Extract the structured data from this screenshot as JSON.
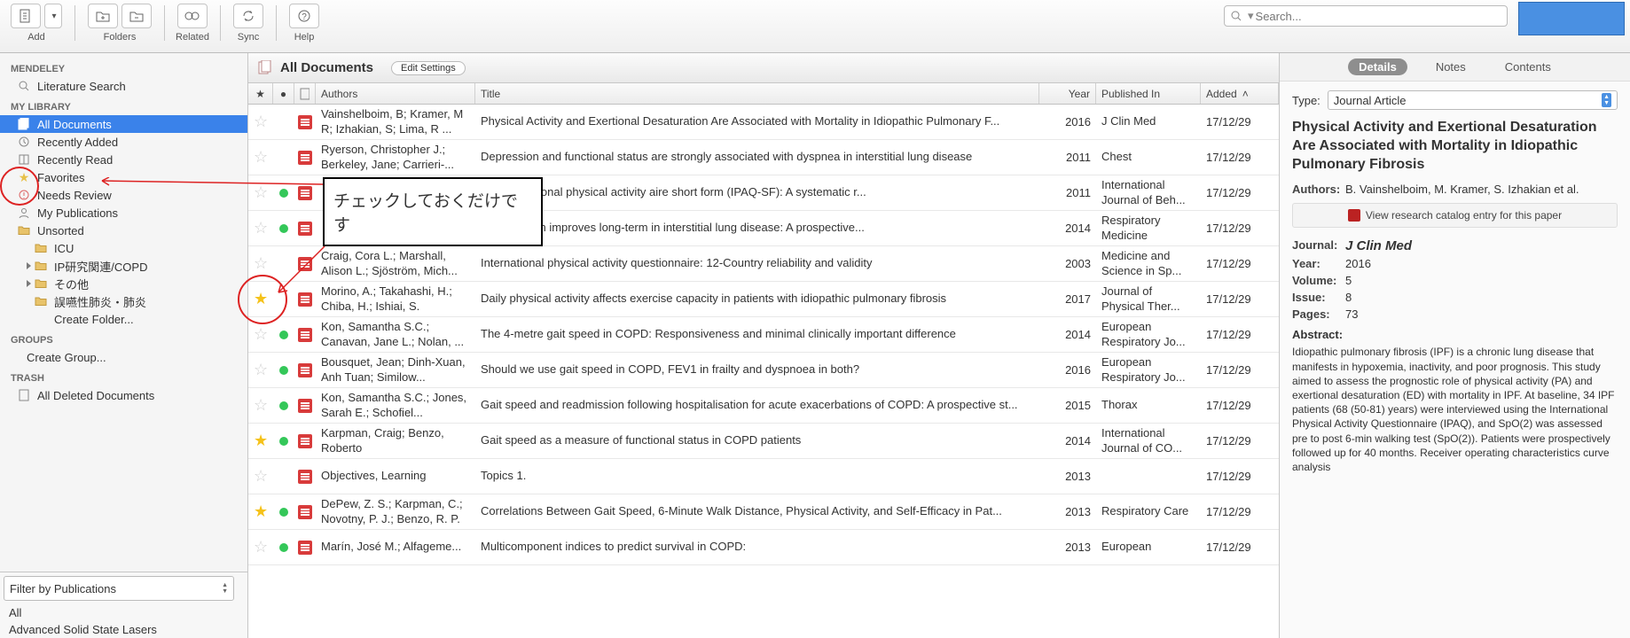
{
  "toolbar": {
    "groups": [
      {
        "label": "Add",
        "icons": [
          "file-add",
          "caret-down"
        ]
      },
      {
        "label": "Folders",
        "icons": [
          "folder-new",
          "folder-del"
        ]
      },
      {
        "label": "Related",
        "icons": [
          "related"
        ]
      },
      {
        "label": "Sync",
        "icons": [
          "sync"
        ]
      },
      {
        "label": "Help",
        "icons": [
          "help"
        ]
      }
    ],
    "search_placeholder": "Search..."
  },
  "sidebar": {
    "mendeley_head": "MENDELEY",
    "lit_search": "Literature Search",
    "lib_head": "MY LIBRARY",
    "items": [
      {
        "label": "All Documents",
        "sel": true,
        "icon": "docs"
      },
      {
        "label": "Recently Added",
        "icon": "clock"
      },
      {
        "label": "Recently Read",
        "icon": "book"
      },
      {
        "label": "Favorites",
        "icon": "star"
      },
      {
        "label": "Needs Review",
        "icon": "warn"
      },
      {
        "label": "My Publications",
        "icon": "user"
      },
      {
        "label": "Unsorted",
        "icon": "folder"
      },
      {
        "label": "ICU",
        "icon": "folder",
        "sub": true
      },
      {
        "label": "IP研究関連/COPD",
        "icon": "folder",
        "sub": true,
        "tri": true
      },
      {
        "label": "その他",
        "icon": "folder",
        "sub": true,
        "tri": true
      },
      {
        "label": "誤嚥性肺炎・肺炎",
        "icon": "folder",
        "sub": true
      },
      {
        "label": "Create Folder...",
        "icon": "none",
        "sub": true
      }
    ],
    "groups_head": "GROUPS",
    "create_group": "Create Group...",
    "trash_head": "TRASH",
    "deleted": "All Deleted Documents",
    "filter_label": "Filter by Publications",
    "filter_items": [
      "All",
      "Advanced Solid State Lasers"
    ]
  },
  "center": {
    "title": "All Documents",
    "edit": "Edit Settings",
    "cols": {
      "authors": "Authors",
      "title": "Title",
      "year": "Year",
      "pub": "Published In",
      "added": "Added"
    },
    "rows": [
      {
        "fav": false,
        "unread": false,
        "pdf": true,
        "authors": "Vainshelboim, B; Kramer, M R; Izhakian, S; Lima, R ...",
        "title": "Physical Activity and Exertional Desaturation Are Associated with Mortality in Idiopathic Pulmonary F...",
        "year": "2016",
        "pub": "J Clin Med",
        "added": "17/12/29"
      },
      {
        "fav": false,
        "unread": false,
        "pdf": true,
        "authors": "Ryerson, Christopher J.; Berkeley, Jane; Carrieri-...",
        "title": "Depression and functional status are strongly associated with dyspnea in interstitial lung disease",
        "year": "2011",
        "pub": "Chest",
        "added": "17/12/29"
      },
      {
        "fav": false,
        "unread": true,
        "pdf": true,
        "authors": "",
        "title": "the international physical activity aire short form (IPAQ-SF): A systematic r...",
        "year": "2011",
        "pub": "International Journal of Beh...",
        "added": "17/12/29"
      },
      {
        "fav": false,
        "unread": true,
        "pdf": true,
        "authors": "",
        "title": "rehabilitation improves long-term in interstitial lung disease: A prospective...",
        "year": "2014",
        "pub": "Respiratory Medicine",
        "added": "17/12/29"
      },
      {
        "fav": false,
        "unread": false,
        "pdf": true,
        "authors": "Craig, Cora L.; Marshall, Alison L.; Sjöström, Mich...",
        "title": "International physical activity questionnaire: 12-Country reliability and validity",
        "year": "2003",
        "pub": "Medicine and Science in Sp...",
        "added": "17/12/29"
      },
      {
        "fav": true,
        "unread": false,
        "pdf": true,
        "authors": "Morino, A.; Takahashi, H.; Chiba, H.; Ishiai, S.",
        "title": "Daily physical activity affects exercise capacity in patients with idiopathic pulmonary fibrosis",
        "year": "2017",
        "pub": "Journal of Physical Ther...",
        "added": "17/12/29"
      },
      {
        "fav": false,
        "unread": true,
        "pdf": true,
        "authors": "Kon, Samantha S.C.; Canavan, Jane L.; Nolan, ...",
        "title": "The 4-metre gait speed in COPD: Responsiveness and minimal clinically important difference",
        "year": "2014",
        "pub": "European Respiratory Jo...",
        "added": "17/12/29"
      },
      {
        "fav": false,
        "unread": true,
        "pdf": true,
        "authors": "Bousquet, Jean; Dinh-Xuan, Anh Tuan; Similow...",
        "title": "Should we use gait speed in COPD, FEV1 in frailty and dyspnoea in both?",
        "year": "2016",
        "pub": "European Respiratory Jo...",
        "added": "17/12/29"
      },
      {
        "fav": false,
        "unread": true,
        "pdf": true,
        "authors": "Kon, Samantha S.C.; Jones, Sarah E.; Schofiel...",
        "title": "Gait speed and readmission following hospitalisation for acute exacerbations of COPD: A prospective st...",
        "year": "2015",
        "pub": "Thorax",
        "added": "17/12/29"
      },
      {
        "fav": true,
        "unread": true,
        "pdf": true,
        "authors": "Karpman, Craig; Benzo, Roberto",
        "title": "Gait speed as a measure of functional status in COPD patients",
        "year": "2014",
        "pub": "International Journal of CO...",
        "added": "17/12/29"
      },
      {
        "fav": false,
        "unread": false,
        "pdf": true,
        "authors": "Objectives, Learning",
        "title": "Topics 1.",
        "year": "2013",
        "pub": "",
        "added": "17/12/29"
      },
      {
        "fav": true,
        "unread": true,
        "pdf": true,
        "authors": "DePew, Z. S.; Karpman, C.; Novotny, P. J.; Benzo, R. P.",
        "title": "Correlations Between Gait Speed, 6-Minute Walk Distance, Physical Activity, and Self-Efficacy in Pat...",
        "year": "2013",
        "pub": "Respiratory Care",
        "added": "17/12/29"
      },
      {
        "fav": false,
        "unread": true,
        "pdf": true,
        "authors": "Marín, José M.; Alfageme...",
        "title": "Multicomponent indices to predict survival in COPD:",
        "year": "2013",
        "pub": "European",
        "added": "17/12/29"
      }
    ]
  },
  "annotation": {
    "text": "チェックしておくだけです"
  },
  "details": {
    "tabs": [
      "Details",
      "Notes",
      "Contents"
    ],
    "type_label": "Type:",
    "type_value": "Journal Article",
    "title": "Physical Activity and Exertional Desaturation Are Associated with Mortality in Idiopathic Pulmonary Fibrosis",
    "authors_label": "Authors:",
    "authors": "B. Vainshelboim, M. Kramer, S. Izhakian et al.",
    "catalog": "View research catalog entry for this paper",
    "journal_label": "Journal:",
    "journal": "J Clin Med",
    "year_label": "Year:",
    "year": "2016",
    "volume_label": "Volume:",
    "volume": "5",
    "issue_label": "Issue:",
    "issue": "8",
    "pages_label": "Pages:",
    "pages": "73",
    "abstract_label": "Abstract:",
    "abstract": "Idiopathic pulmonary fibrosis (IPF) is a chronic lung disease that manifests in hypoxemia, inactivity, and poor prognosis. This study aimed to assess the prognostic role of physical activity (PA) and exertional desaturation (ED) with mortality in IPF. At baseline, 34 IPF patients (68 (50-81) years) were interviewed using the International Physical Activity Questionnaire (IPAQ), and SpO(2) was assessed pre to post 6-min walking test (SpO(2)). Patients were prospectively followed up for 40 months. Receiver operating characteristics curve analysis"
  }
}
